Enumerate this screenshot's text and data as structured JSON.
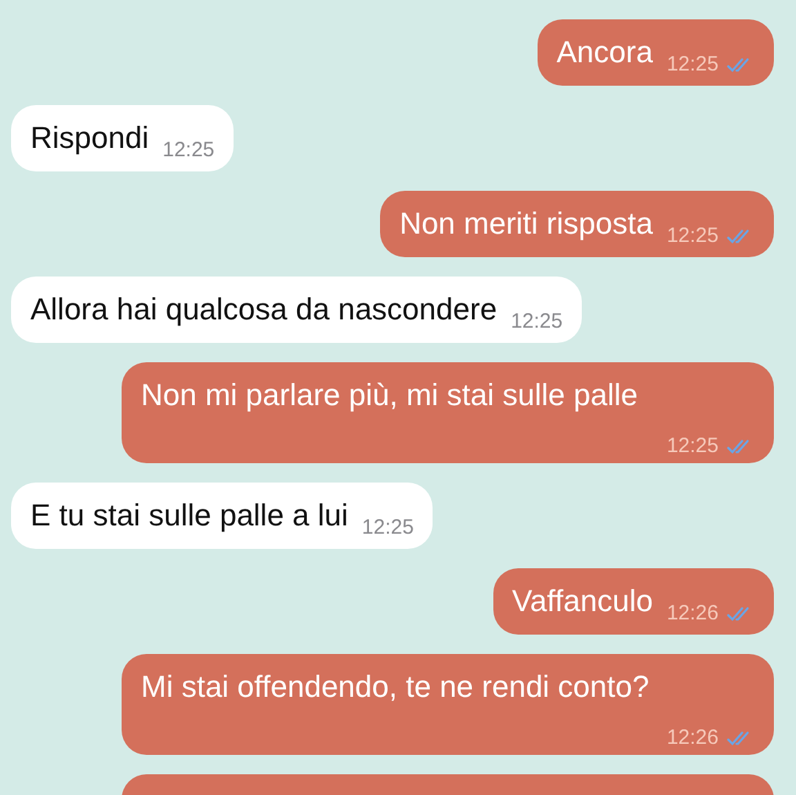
{
  "messages": [
    {
      "kind": "outgoing",
      "text": "Ancora",
      "time": "12:25",
      "read": true,
      "wide": false
    },
    {
      "kind": "incoming",
      "text": "Rispondi",
      "time": "12:25",
      "wide": false
    },
    {
      "kind": "outgoing",
      "text": "Non meriti risposta",
      "time": "12:25",
      "read": true,
      "wide": false
    },
    {
      "kind": "incoming",
      "text": "Allora hai qualcosa da nascondere",
      "time": "12:25",
      "wide": false
    },
    {
      "kind": "outgoing",
      "text": "Non mi parlare più, mi stai sulle palle",
      "time": "12:25",
      "read": true,
      "wide": true
    },
    {
      "kind": "incoming",
      "text": "E tu stai sulle palle a lui",
      "time": "12:25",
      "wide": false
    },
    {
      "kind": "outgoing",
      "text": "Vaffanculo",
      "time": "12:26",
      "read": true,
      "wide": false
    },
    {
      "kind": "outgoing",
      "text": "Mi stai offendendo, te ne rendi conto?",
      "time": "12:26",
      "read": true,
      "wide": true
    },
    {
      "kind": "outgoing-cut"
    }
  ]
}
